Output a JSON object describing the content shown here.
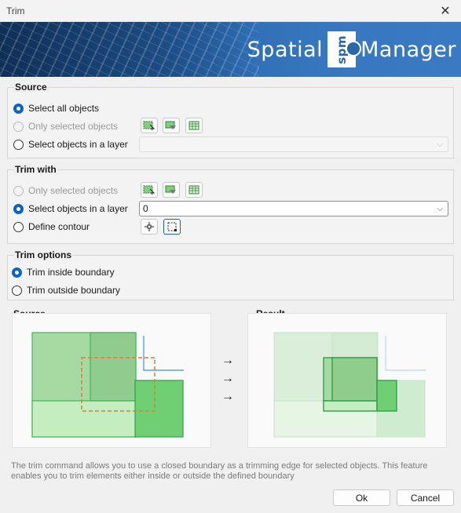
{
  "window": {
    "title": "Trim",
    "close_icon": "close-icon"
  },
  "banner": {
    "brand_left": "Spatial",
    "brand_logo": "spm",
    "brand_right": "Manager"
  },
  "source": {
    "title": "Source",
    "select_all": "Select all objects",
    "only_selected": "Only selected objects",
    "select_in_layer": "Select objects in a layer",
    "layer_value": "",
    "selected_option": "select_all"
  },
  "trim_with": {
    "title": "Trim with",
    "only_selected": "Only selected objects",
    "select_in_layer": "Select objects in a layer",
    "layer_value": "0",
    "define_contour": "Define contour",
    "selected_option": "select_in_layer"
  },
  "trim_options": {
    "title": "Trim options",
    "inside": "Trim inside boundary",
    "outside": "Trim outside boundary",
    "selected_option": "inside"
  },
  "preview": {
    "source_title": "Source",
    "result_title": "Result",
    "arrow": "→"
  },
  "description": "The trim command allows you to use a closed boundary as a trimming edge for selected objects. This feature enables you to trim elements either inside or outside the defined boundary",
  "buttons": {
    "ok": "Ok",
    "cancel": "Cancel"
  },
  "colors": {
    "accent": "#0a64c8",
    "banner": "#2c6bb1",
    "green_shape": "#5cc463",
    "contour": "#e07b39"
  }
}
